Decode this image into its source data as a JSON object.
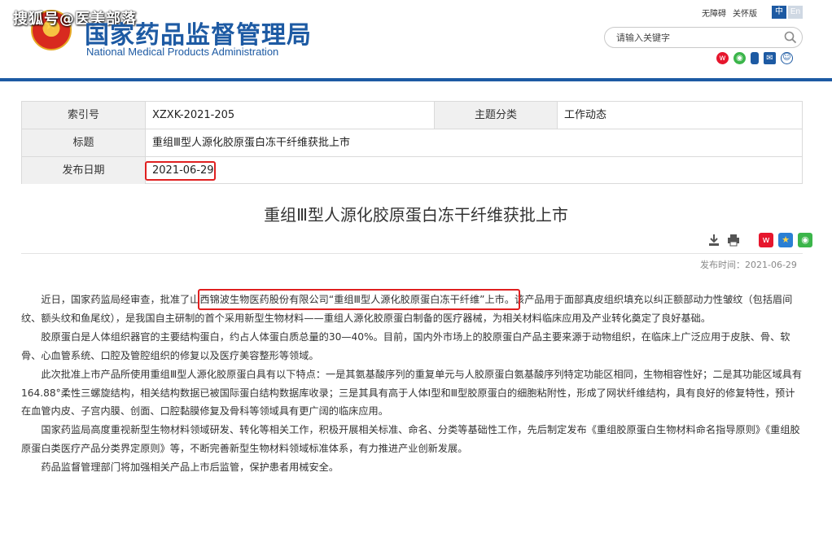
{
  "header": {
    "watermark": "搜狐号@医美部落",
    "logo_cn": "国家药品监督管理局",
    "logo_en": "National Medical Products Administration",
    "links": [
      "无障碍",
      "关怀版"
    ],
    "lang_cn": "中",
    "lang_en": "En",
    "search_placeholder": "请输入关键字",
    "icons": [
      "weibo-icon",
      "wechat-icon",
      "mobile-icon",
      "mail-icon",
      "user-icon"
    ]
  },
  "meta": {
    "index_label": "索引号",
    "index_value": "XZXK-2021-205",
    "category_label": "主题分类",
    "category_value": "工作动态",
    "title_label": "标题",
    "title_value": "重组Ⅲ型人源化胶原蛋白冻干纤维获批上市",
    "date_label": "发布日期",
    "date_value": "2021-06-29"
  },
  "article": {
    "title": "重组Ⅲ型人源化胶原蛋白冻干纤维获批上市",
    "publish_time": "发布时间：2021-06-29",
    "paragraphs": [
      "近日，国家药监局经审查，批准了山西锦波生物医药股份有限公司“重组Ⅲ型人源化胶原蛋白冻干纤维”上市。该产品用于面部真皮组织填充以纠正额部动力性皱纹（包括眉间纹、额头纹和鱼尾纹），是我国自主研制的首个采用新型生物材料——重组人源化胶原蛋白制备的医疗器械，为相关材料临床应用及产业转化奠定了良好基础。",
      "胶原蛋白是人体组织器官的主要结构蛋白，约占人体蛋白质总量的30—40%。目前，国内外市场上的胶原蛋白产品主要来源于动物组织，在临床上广泛应用于皮肤、骨、软骨、心血管系统、口腔及管腔组织的修复以及医疗美容整形等领域。",
      "此次批准上市产品所使用重组Ⅲ型人源化胶原蛋白具有以下特点：一是其氨基酸序列的重复单元与人胶原蛋白氨基酸序列特定功能区相同，生物相容性好；二是其功能区域具有164.88°柔性三螺旋结构，相关结构数据已被国际蛋白结构数据库收录；三是其具有高于人体Ⅰ型和Ⅲ型胶原蛋白的细胞粘附性，形成了网状纤维结构，具有良好的修复特性，预计在血管内皮、子宫内膜、创面、口腔黏膜修复及骨科等领域具有更广阔的临床应用。",
      "国家药监局高度重视新型生物材料领域研发、转化等相关工作，积极开展相关标准、命名、分类等基础性工作，先后制定发布《重组胶原蛋白生物材料命名指导原则》《重组胶原蛋白类医疗产品分类界定原则》等，不断完善新型生物材料领域标准体系，有力推进产业创新发展。",
      "药品监督管理部门将加强相关产品上市后监管，保护患者用械安全。"
    ]
  }
}
